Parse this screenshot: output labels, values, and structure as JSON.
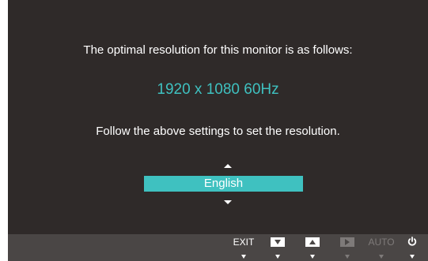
{
  "osd": {
    "message_top": "The optimal resolution for this monitor is as follows:",
    "resolution": "1920 x 1080  60Hz",
    "message_bottom": "Follow the above settings to set the resolution.",
    "language_selected": "English"
  },
  "bottom_bar": {
    "exit_label": "EXIT",
    "auto_label": "AUTO",
    "icons": [
      "down-button-icon",
      "up-button-icon",
      "enter-button-icon",
      "power-icon"
    ]
  },
  "colors": {
    "background": "#2f2a29",
    "accent": "#3fc1c0",
    "bar": "#4a4645",
    "dimmed": "#7e7a79"
  }
}
